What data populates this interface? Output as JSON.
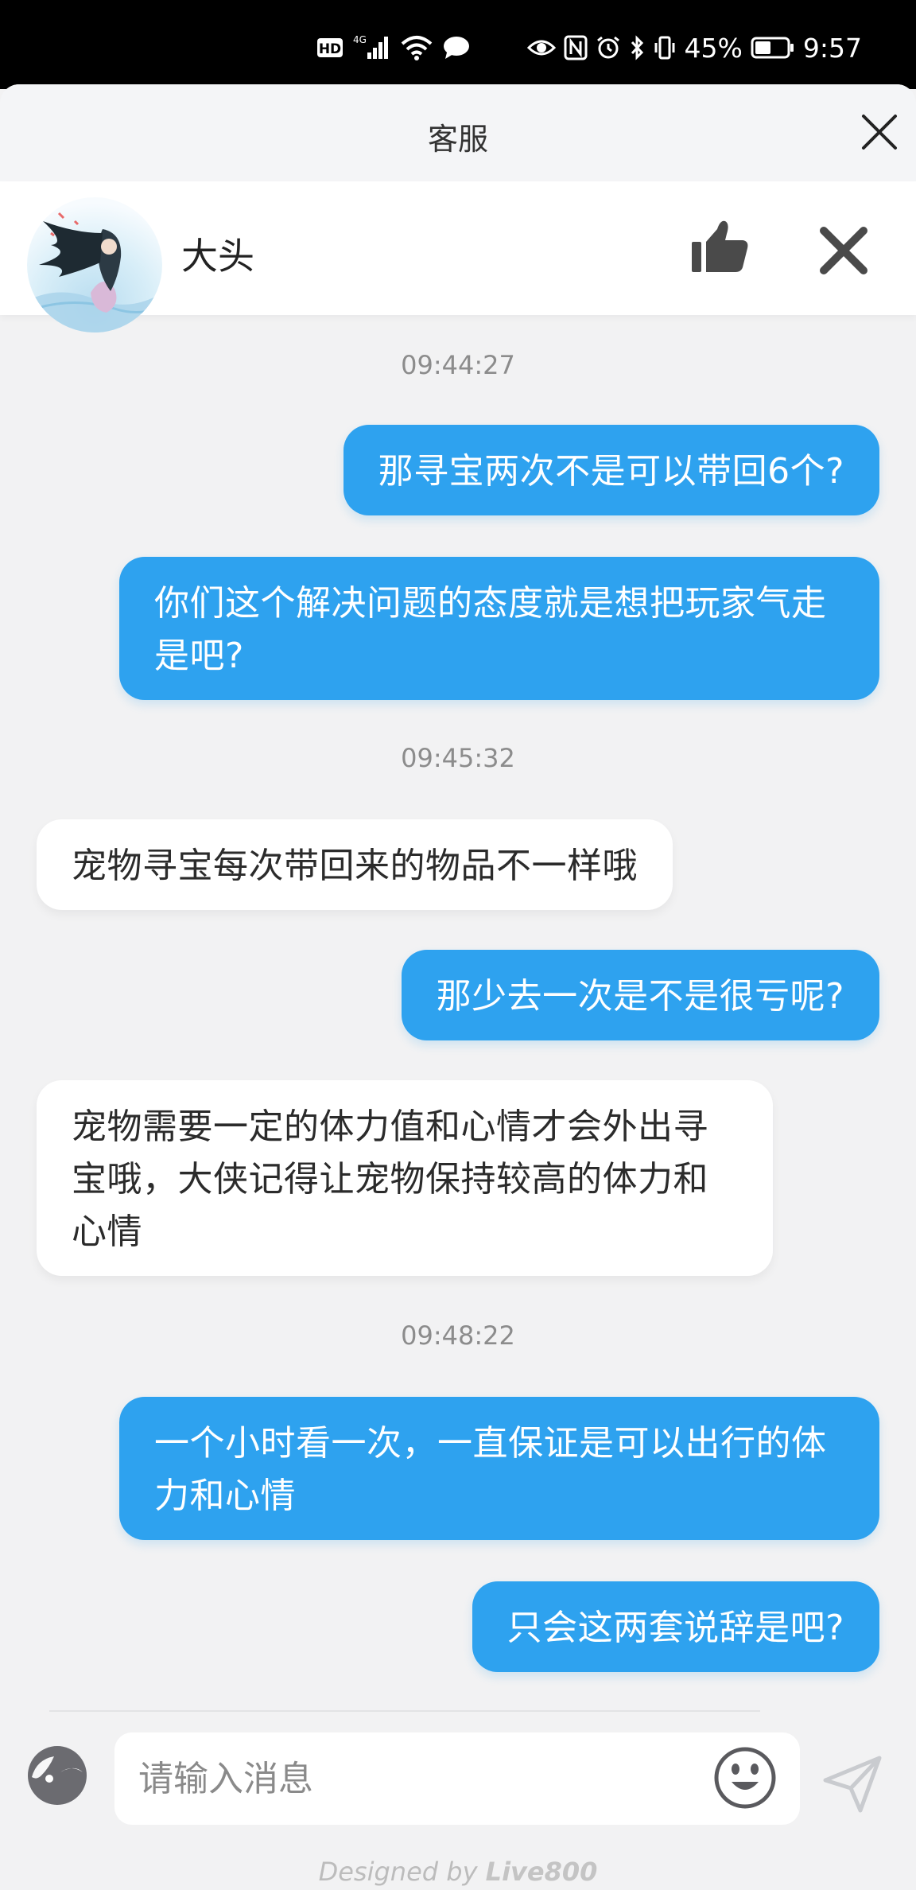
{
  "status_bar": {
    "left_icons": [
      "hd-icon",
      "4g-signal-icon",
      "wifi-icon",
      "message-icon"
    ],
    "battery_percent": "45%",
    "time": "9:57"
  },
  "header": {
    "title": "客服",
    "agent_name": "大头"
  },
  "messages": [
    {
      "type": "timestamp",
      "text": "09:44:27"
    },
    {
      "type": "out",
      "text": "那寻宝两次不是可以带回6个?"
    },
    {
      "type": "out",
      "text": "你们这个解决问题的态度就是想把玩家气走是吧?"
    },
    {
      "type": "timestamp",
      "text": "09:45:32"
    },
    {
      "type": "in",
      "text": "宠物寻宝每次带回来的物品不一样哦"
    },
    {
      "type": "out",
      "text": "那少去一次是不是很亏呢?"
    },
    {
      "type": "in",
      "text": "宠物需要一定的体力值和心情才会外出寻宝哦，大侠记得让宠物保持较高的体力和心情"
    },
    {
      "type": "timestamp",
      "text": "09:48:22"
    },
    {
      "type": "out",
      "text": "一个小时看一次，一直保证是可以出行的体力和心情"
    },
    {
      "type": "out",
      "text": "只会这两套说辞是吧?"
    }
  ],
  "input": {
    "placeholder": "请输入消息"
  },
  "footer": {
    "prefix": "Designed by ",
    "brand": "Live800"
  },
  "colors": {
    "outgoing_bubble": "#2ea2ef",
    "incoming_bubble": "#ffffff",
    "background": "#f2f2f3"
  }
}
